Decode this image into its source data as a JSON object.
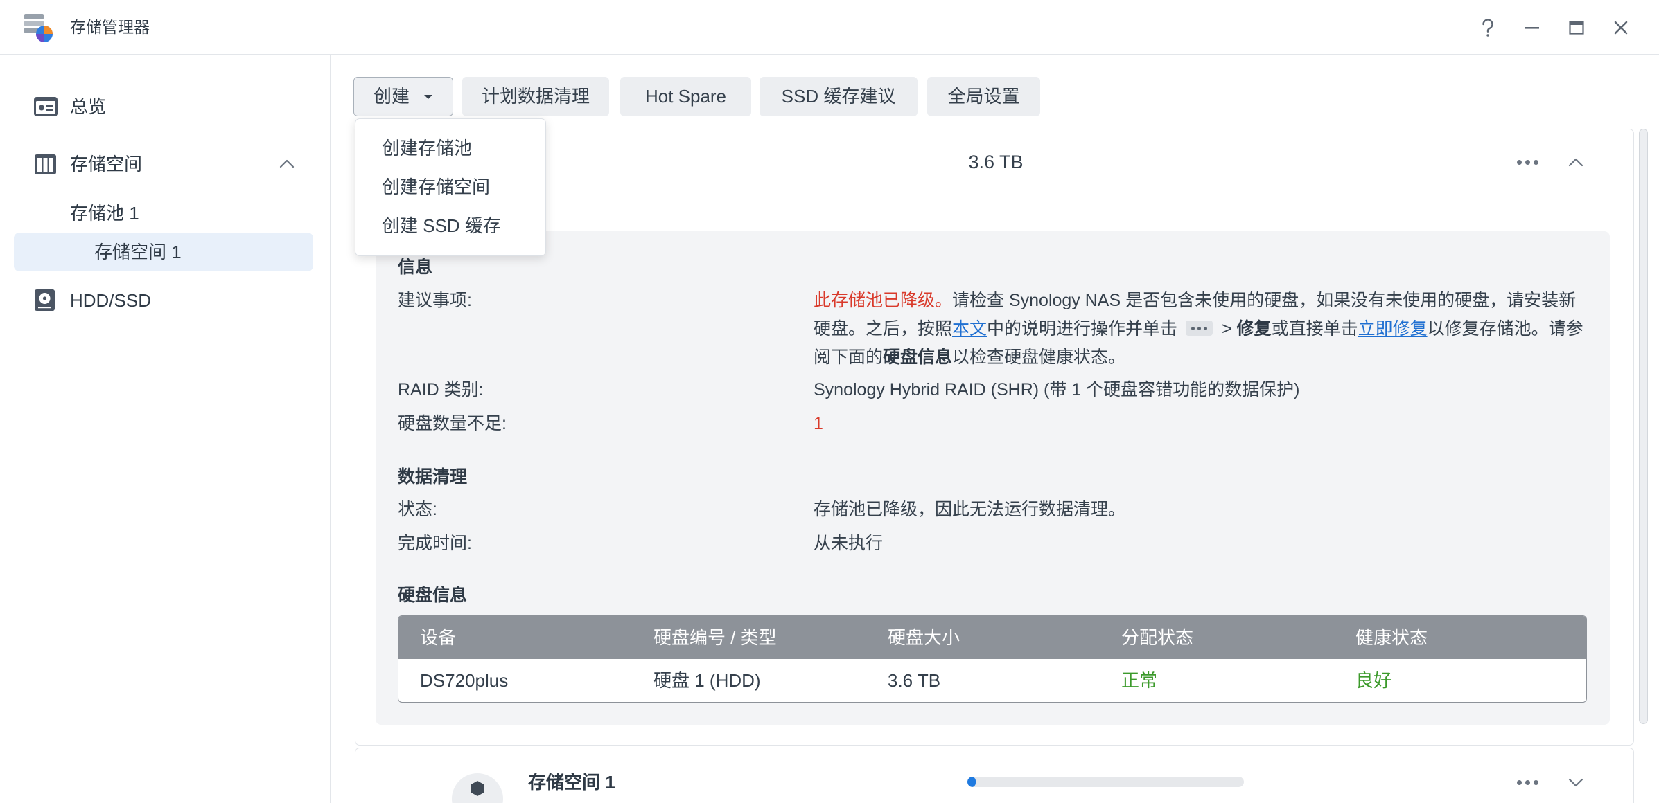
{
  "window": {
    "title": "存储管理器",
    "app_icon": "storage-manager-app-icon",
    "controls": [
      "help-icon",
      "minimize-icon",
      "maximize-icon",
      "close-icon"
    ]
  },
  "sidebar": {
    "items": [
      {
        "label": "总览",
        "icon": "overview-icon"
      },
      {
        "label": "存储空间",
        "icon": "storage-icon",
        "expanded": true
      },
      {
        "label": "存储池 1"
      },
      {
        "label": "存储空间 1",
        "selected": true
      },
      {
        "label": "HDD/SSD",
        "icon": "hdd-ssd-icon"
      }
    ]
  },
  "toolbar": {
    "create": "创建",
    "schedule_scrubbing": "计划数据清理",
    "hot_spare": "Hot Spare",
    "ssd_cache_advisor": "SSD 缓存建议",
    "global_settings": "全局设置"
  },
  "create_menu": {
    "open": true,
    "items": [
      "创建存储池",
      "创建存储空间",
      "创建 SSD 缓存"
    ]
  },
  "pool_card": {
    "size": "3.6 TB",
    "expanded": true,
    "info": {
      "heading": "信息",
      "recommendation": {
        "label": "建议事项:",
        "degraded": "此存储池已降级。",
        "text_1": "请检查 Synology NAS 是否包含未使用的硬盘，如果没有未使用的硬盘，请安装新硬盘。之后，按照",
        "link_article": "本文",
        "text_2": "中的说明进行操作并单击",
        "more_icon": "more-actions-icon",
        "text_3": " > ",
        "repair": "修复",
        "text_4": "或直接单击",
        "link_repair": "立即修复",
        "text_5": "以修复存储池。请参阅下面的",
        "drive_info": "硬盘信息",
        "text_6": "以检查硬盘健康状态。"
      },
      "raid_type": {
        "label": "RAID 类别:",
        "value": "Synology Hybrid RAID (SHR) (带 1 个硬盘容错功能的数据保护)"
      },
      "missing_drives": {
        "label": "硬盘数量不足:",
        "value": "1"
      }
    },
    "scrubbing": {
      "heading": "数据清理",
      "status": {
        "label": "状态:",
        "value": "存储池已降级，因此无法运行数据清理。"
      },
      "completed": {
        "label": "完成时间:",
        "value": "从未执行"
      }
    },
    "drives": {
      "heading": "硬盘信息",
      "headers": [
        "设备",
        "硬盘编号 / 类型",
        "硬盘大小",
        "分配状态",
        "健康状态"
      ],
      "rows": [
        [
          "DS720plus",
          "硬盘 1 (HDD)",
          "3.6 TB",
          "正常",
          "良好"
        ]
      ]
    }
  },
  "volume_card": {
    "name": "存储空间 1",
    "usage_fraction": 0.03,
    "expanded": false
  },
  "colors": {
    "accent": "#1f6fd1",
    "error": "#d93a2b",
    "healthy": "#3c9a2b",
    "selected_bg": "#e8f0fa",
    "table_header": "#8d9299"
  }
}
